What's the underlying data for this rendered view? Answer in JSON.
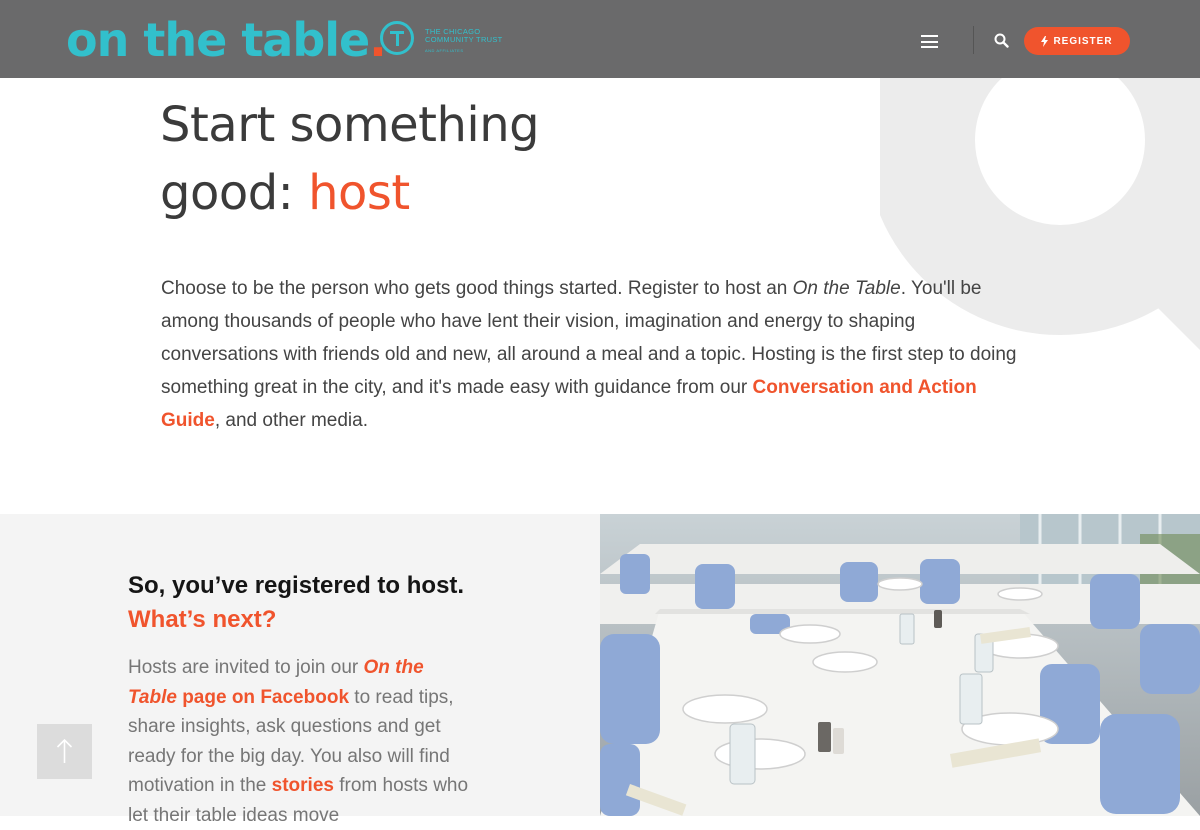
{
  "header": {
    "logo_text": "on the table",
    "logo_dot": ".",
    "partner_line1": "THE CHICAGO",
    "partner_line2": "COMMUNITY TRUST",
    "partner_line3": "AND AFFILIATES",
    "register_label": "REGISTER"
  },
  "hero": {
    "title_line1": "Start something",
    "title_prefix": "good: ",
    "title_accent": "host",
    "body_part1": "Choose to be the person who gets good things started. Register to host an ",
    "body_italic": "On the Table",
    "body_part2": ". You'll be among thousands of people who have lent their vision, imagination and energy to shaping conversations with friends old and new, all around a meal and a topic. Hosting is the first step to doing something great in the city, and it's made easy with guidance from our ",
    "guide_link": "Conversation and Action Guide",
    "body_part3": ", and other media."
  },
  "next_section": {
    "title": "So, you’ve registered to host.",
    "title_accent": "What’s next?",
    "body_part1": "Hosts are invited to join our ",
    "facebook_link_italic": "On the Table",
    "facebook_link_rest": " page on Facebook",
    "body_part2": " to read tips, share insights, ask questions and get ready for the big day. You also will find motivation in the ",
    "stories_link": "stories",
    "body_part3": " from hosts who let their table ideas move"
  },
  "colors": {
    "brand_teal": "#32c0cc",
    "accent_orange": "#f0542d",
    "header_gray": "#6a6a6b"
  },
  "icons": [
    "menu-icon",
    "search-icon",
    "bolt-icon",
    "arrow-up-icon",
    "speech-bubble-icon"
  ]
}
